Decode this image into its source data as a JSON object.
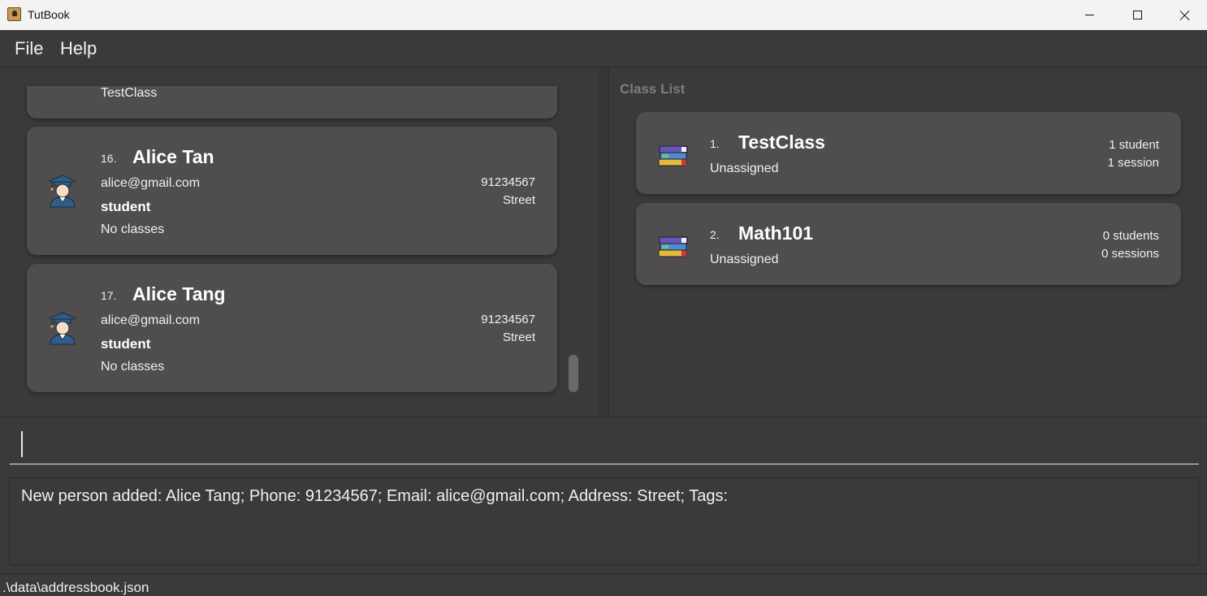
{
  "window": {
    "title": "TutBook",
    "icon": "address-book-icon"
  },
  "menu": {
    "file": "File",
    "help": "Help"
  },
  "person_list": {
    "partial_card": {
      "class_text": "TestClass"
    },
    "persons": [
      {
        "index": "16.",
        "name": "Alice Tan",
        "email": "alice@gmail.com",
        "role": "student",
        "classes": "No classes",
        "phone": "91234567",
        "address": "Street",
        "icon": "student-avatar-icon"
      },
      {
        "index": "17.",
        "name": "Alice Tang",
        "email": "alice@gmail.com",
        "role": "student",
        "classes": "No classes",
        "phone": "91234567",
        "address": "Street",
        "icon": "student-avatar-icon"
      }
    ]
  },
  "class_list": {
    "title": "Class List",
    "classes": [
      {
        "index": "1.",
        "name": "TestClass",
        "tutor": "Unassigned",
        "students": "1 student",
        "sessions": "1 session",
        "icon": "books-icon"
      },
      {
        "index": "2.",
        "name": "Math101",
        "tutor": "Unassigned",
        "students": "0 students",
        "sessions": "0 sessions",
        "icon": "books-icon"
      }
    ]
  },
  "command_box": {
    "value": "",
    "placeholder": ""
  },
  "result_display": {
    "text": "New person added: Alice Tang; Phone: 91234567; Email: alice@gmail.com; Address: Street; Tags:"
  },
  "status_bar": {
    "path": ".\\data\\addressbook.json"
  },
  "colors": {
    "background": "#3a3a3a",
    "card": "#4f4d4e",
    "text": "#f0f0f0",
    "muted_title": "#7d7d7d"
  }
}
